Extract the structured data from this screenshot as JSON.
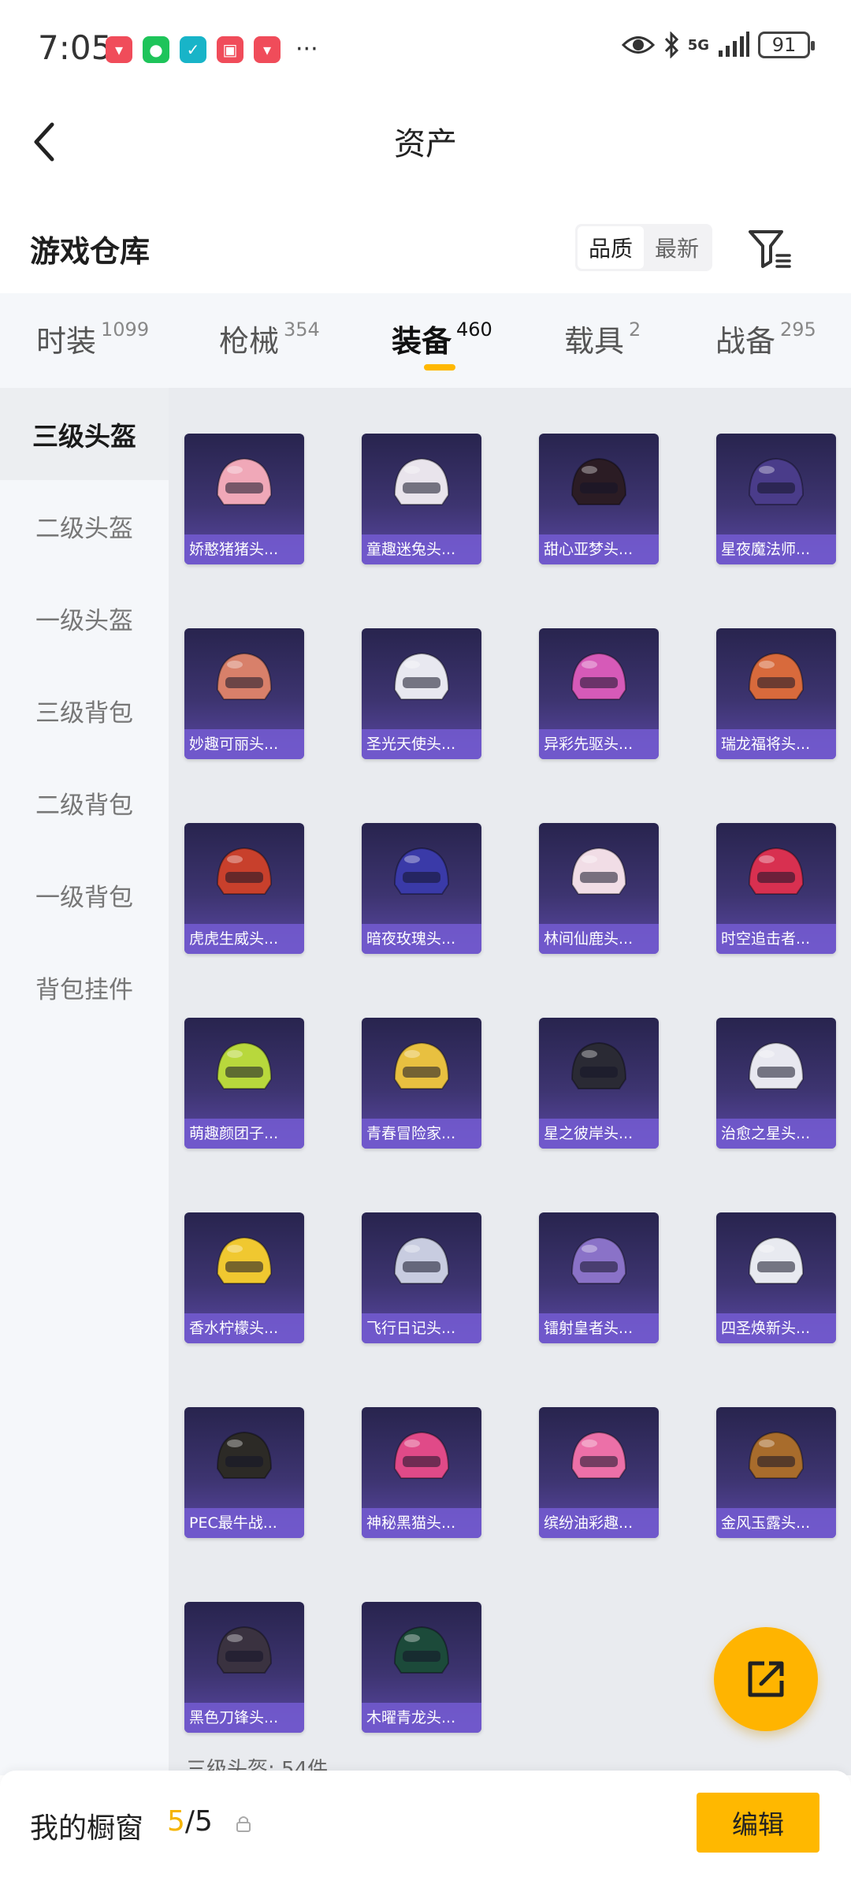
{
  "status_bar": {
    "time": "7:05",
    "more": "···",
    "network": "5G",
    "battery": "91"
  },
  "header": {
    "title": "资产"
  },
  "section": {
    "title": "游戏仓库",
    "sort_options": [
      "品质",
      "最新"
    ],
    "active_sort": "品质"
  },
  "tabs": [
    {
      "label": "时装",
      "count": "1099"
    },
    {
      "label": "枪械",
      "count": "354"
    },
    {
      "label": "装备",
      "count": "460",
      "active": true
    },
    {
      "label": "载具",
      "count": "2"
    },
    {
      "label": "战备",
      "count": "295"
    }
  ],
  "sidebar": {
    "items": [
      "三级头盔",
      "二级头盔",
      "一级头盔",
      "三级背包",
      "二级背包",
      "一级背包",
      "背包挂件"
    ],
    "active": "三级头盔"
  },
  "items": [
    {
      "name": "娇憨猪猪头...",
      "color": "#f0a8b8"
    },
    {
      "name": "童趣迷兔头...",
      "color": "#e9e4ec"
    },
    {
      "name": "甜心亚梦头...",
      "color": "#2b1c24"
    },
    {
      "name": "星夜魔法师...",
      "color": "#4a3c8a"
    },
    {
      "name": "妙趣可丽头...",
      "color": "#d8806a"
    },
    {
      "name": "圣光天使头...",
      "color": "#e8e8f0"
    },
    {
      "name": "异彩先驱头...",
      "color": "#d65ab8"
    },
    {
      "name": "瑞龙福将头...",
      "color": "#d86a3c"
    },
    {
      "name": "虎虎生威头...",
      "color": "#c8402c"
    },
    {
      "name": "暗夜玫瑰头...",
      "color": "#3a3aa8"
    },
    {
      "name": "林间仙鹿头...",
      "color": "#f1dde6"
    },
    {
      "name": "时空追击者...",
      "color": "#d83050"
    },
    {
      "name": "萌趣颜团子...",
      "color": "#b8d83c"
    },
    {
      "name": "青春冒险家...",
      "color": "#e8c040"
    },
    {
      "name": "星之彼岸头...",
      "color": "#2a2a34"
    },
    {
      "name": "治愈之星头...",
      "color": "#e8e8f0"
    },
    {
      "name": "香水柠檬头...",
      "color": "#f0c830"
    },
    {
      "name": "飞行日记头...",
      "color": "#c8cce0"
    },
    {
      "name": "镭射皇者头...",
      "color": "#8a72c8"
    },
    {
      "name": "四圣焕新头...",
      "color": "#e8eaf0"
    },
    {
      "name": "PEC最牛战...",
      "color": "#2c2a26"
    },
    {
      "name": "神秘黑猫头...",
      "color": "#e04a88"
    },
    {
      "name": "缤纷油彩趣...",
      "color": "#ec70a8"
    },
    {
      "name": "金风玉露头...",
      "color": "#a86c2c"
    },
    {
      "name": "黑色刀锋头...",
      "color": "#3a3240"
    },
    {
      "name": "木曜青龙头...",
      "color": "#1c4a3a"
    }
  ],
  "summary": "三级头盔: 54件",
  "bottom": {
    "label": "我的橱窗",
    "count_current": "5",
    "count_sep_total": "/5",
    "edit_label": "编辑"
  },
  "colors": {
    "accent": "#ffb800",
    "card_top": "#28244e",
    "card_bottom": "#5b48a6"
  }
}
